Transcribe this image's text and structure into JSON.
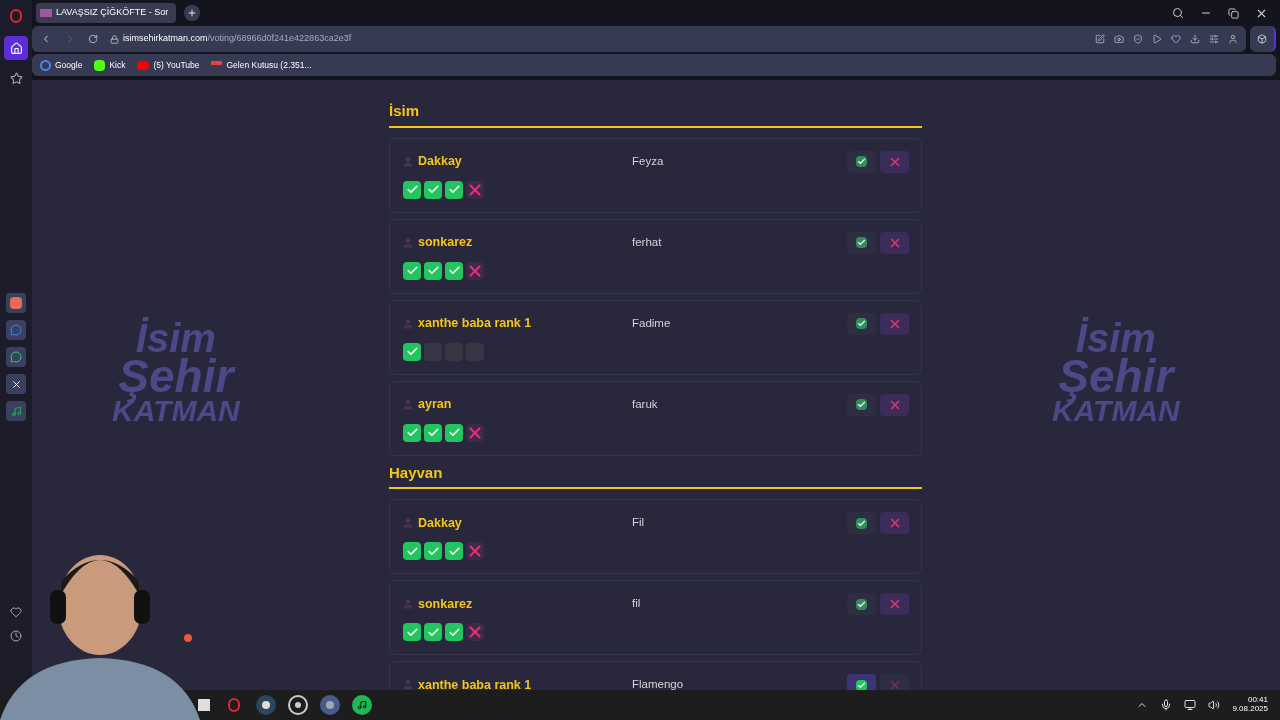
{
  "browser": {
    "tab": {
      "title": "LAVAŞSIZ ÇİĞKÖFTE - Sor"
    },
    "url": {
      "host": "isimsehirkatman.com",
      "path": "/voting/68966d0f241e422863ca2e3f"
    },
    "bookmarks": [
      {
        "label": "Google",
        "kind": "google"
      },
      {
        "label": "Kick",
        "kind": "kick"
      },
      {
        "label": "(5) YouTube",
        "kind": "youtube"
      },
      {
        "label": "Gelen Kutusu (2.351...",
        "kind": "gmail"
      }
    ]
  },
  "background_logos": [
    {
      "lines": [
        "İsim",
        "Şehir",
        "KATMAN"
      ]
    },
    {
      "lines": [
        "İsim",
        "Şehir",
        "KATMAN"
      ]
    }
  ],
  "sections": [
    {
      "title": "İsim",
      "entries": [
        {
          "player": "Dakkay",
          "answer": "Feyza",
          "buttons": [
            {
              "kind": "approve",
              "selected": false
            },
            {
              "kind": "reject",
              "selected": true
            }
          ],
          "votes": [
            {
              "kind": "yes"
            },
            {
              "kind": "yes"
            },
            {
              "kind": "yes"
            },
            {
              "kind": "no"
            }
          ]
        },
        {
          "player": "sonkarez",
          "answer": "ferhat",
          "buttons": [
            {
              "kind": "approve",
              "selected": false
            },
            {
              "kind": "reject",
              "selected": true
            }
          ],
          "votes": [
            {
              "kind": "yes"
            },
            {
              "kind": "yes"
            },
            {
              "kind": "yes"
            },
            {
              "kind": "no"
            }
          ]
        },
        {
          "player": "xanthe baba rank 1",
          "answer": "Fadime",
          "buttons": [
            {
              "kind": "approve",
              "selected": false
            },
            {
              "kind": "reject",
              "selected": true
            }
          ],
          "votes": [
            {
              "kind": "yes"
            },
            {
              "kind": "empty"
            },
            {
              "kind": "empty"
            },
            {
              "kind": "empty"
            }
          ]
        },
        {
          "player": "ayran",
          "answer": "faruk",
          "buttons": [
            {
              "kind": "approve",
              "selected": false
            },
            {
              "kind": "reject",
              "selected": true
            }
          ],
          "votes": [
            {
              "kind": "yes"
            },
            {
              "kind": "yes"
            },
            {
              "kind": "yes"
            },
            {
              "kind": "no"
            }
          ]
        }
      ]
    },
    {
      "title": "Hayvan",
      "entries": [
        {
          "player": "Dakkay",
          "answer": "Fil",
          "buttons": [
            {
              "kind": "approve",
              "selected": false
            },
            {
              "kind": "reject",
              "selected": true
            }
          ],
          "votes": [
            {
              "kind": "yes"
            },
            {
              "kind": "yes"
            },
            {
              "kind": "yes"
            },
            {
              "kind": "no"
            }
          ]
        },
        {
          "player": "sonkarez",
          "answer": "fil",
          "buttons": [
            {
              "kind": "approve",
              "selected": false
            },
            {
              "kind": "reject",
              "selected": true
            }
          ],
          "votes": [
            {
              "kind": "yes"
            },
            {
              "kind": "yes"
            },
            {
              "kind": "yes"
            },
            {
              "kind": "no"
            }
          ]
        },
        {
          "player": "xanthe baba rank 1",
          "answer": "Flamengo",
          "buttons": [
            {
              "kind": "approve",
              "selected": true
            },
            {
              "kind": "reject",
              "selected": false
            }
          ]
        }
      ]
    }
  ],
  "taskbar": {
    "time": "00:41",
    "date": "9.08.2025"
  }
}
